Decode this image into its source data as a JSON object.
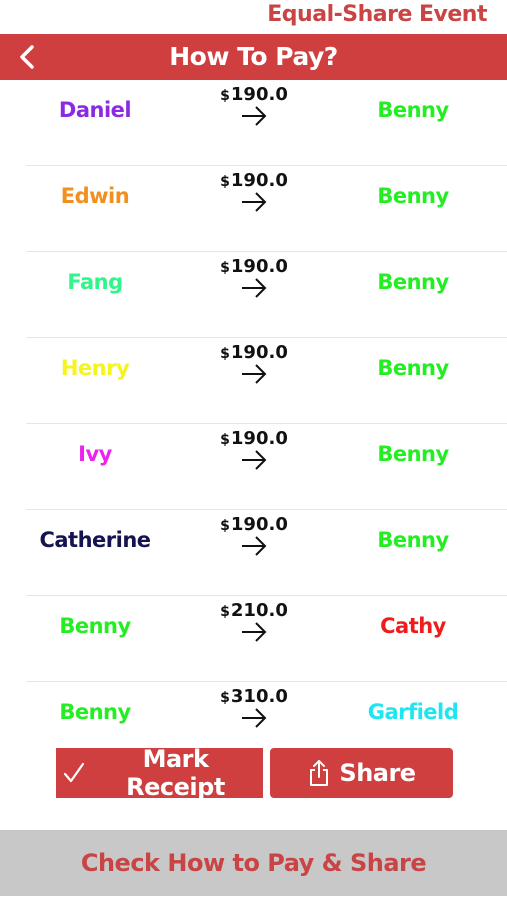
{
  "event_title": "Equal-Share Event",
  "header": {
    "title": "How To Pay?"
  },
  "currency_symbol": "$",
  "payments": [
    {
      "from": "Daniel",
      "from_color": "#8a2be2",
      "amount": "190.0",
      "to": "Benny",
      "to_color": "#22ee22"
    },
    {
      "from": "Edwin",
      "from_color": "#f0901e",
      "amount": "190.0",
      "to": "Benny",
      "to_color": "#22ee22"
    },
    {
      "from": "Fang",
      "from_color": "#2ff58a",
      "amount": "190.0",
      "to": "Benny",
      "to_color": "#22ee22"
    },
    {
      "from": "Henry",
      "from_color": "#f5f51e",
      "amount": "190.0",
      "to": "Benny",
      "to_color": "#22ee22"
    },
    {
      "from": "Ivy",
      "from_color": "#ee22ee",
      "amount": "190.0",
      "to": "Benny",
      "to_color": "#22ee22"
    },
    {
      "from": "Catherine",
      "from_color": "#141450",
      "amount": "190.0",
      "to": "Benny",
      "to_color": "#22ee22"
    },
    {
      "from": "Benny",
      "from_color": "#22ee22",
      "amount": "210.0",
      "to": "Cathy",
      "to_color": "#ee1c1c"
    },
    {
      "from": "Benny",
      "from_color": "#22ee22",
      "amount": "310.0",
      "to": "Garfield",
      "to_color": "#1ee6f0"
    }
  ],
  "buttons": {
    "mark_receipt": "Mark Receipt",
    "share": "Share",
    "check": "Check How to Pay & Share"
  },
  "icons": {
    "back": "chevron-left-icon",
    "arrow": "arrow-right-icon",
    "check": "checkmark-icon",
    "share": "share-icon"
  },
  "colors": {
    "accent": "#cf3f3f",
    "footer_bg": "#c8c8c8",
    "footer_text": "#c94444"
  }
}
